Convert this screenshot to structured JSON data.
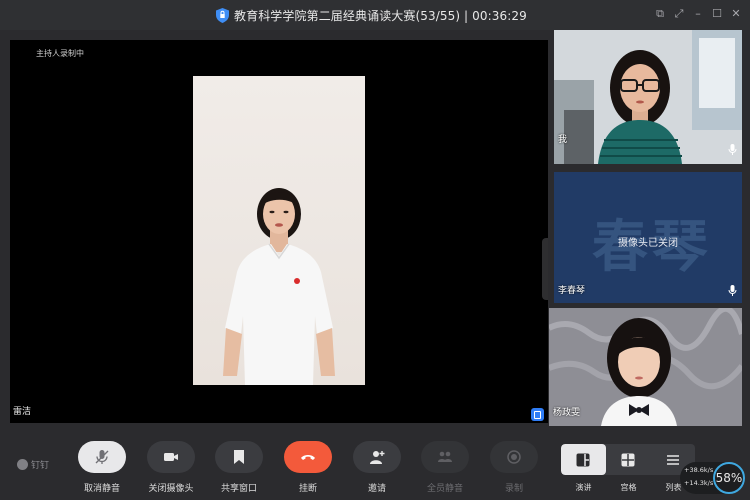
{
  "window": {
    "title": "教育科学学院第二届经典诵读大赛(53/55) | 00:36:29",
    "controls": [
      "expand-icon",
      "fullscreen-icon",
      "minimize-icon",
      "maximize-icon",
      "close-icon"
    ]
  },
  "stage": {
    "host_recording_label": "主持人录制中",
    "speaker_name": "雷洁"
  },
  "thumbnails": [
    {
      "name": "我",
      "camera_on": true,
      "mic_icon": "mic-icon"
    },
    {
      "name": "李春琴",
      "avatar_text": "春琴",
      "camera_status": "摄像头已关闭",
      "mic_icon": "mic-icon"
    },
    {
      "name": "杨政雯",
      "camera_on": true
    }
  ],
  "toolbar": {
    "logo_text": "钉钉",
    "buttons": [
      {
        "label": "取消静音",
        "icon": "microphone-icon",
        "state": "active"
      },
      {
        "label": "关闭摄像头",
        "icon": "camera-icon"
      },
      {
        "label": "共享窗口",
        "icon": "share-window-icon"
      },
      {
        "label": "挂断",
        "icon": "hangup-icon",
        "color": "#f35a3b"
      },
      {
        "label": "邀请",
        "icon": "invite-icon"
      },
      {
        "label": "全员静音",
        "icon": "mute-all-icon",
        "enabled": false
      },
      {
        "label": "录制",
        "icon": "record-icon",
        "enabled": false
      }
    ],
    "layouts": [
      {
        "label": "演讲",
        "icon": "speaker-layout-icon",
        "selected": true
      },
      {
        "label": "宫格",
        "icon": "grid-layout-icon"
      },
      {
        "label": "列表",
        "icon": "list-layout-icon"
      }
    ]
  },
  "network": {
    "upload": "+38.6",
    "upload_unit": "k/s",
    "download": "+14.3",
    "download_unit": "k/s",
    "cpu_percent": "58%"
  },
  "colors": {
    "accent_blue": "#2f7df6",
    "hangup_red": "#f35a3b",
    "background": "#2b2b2e"
  }
}
